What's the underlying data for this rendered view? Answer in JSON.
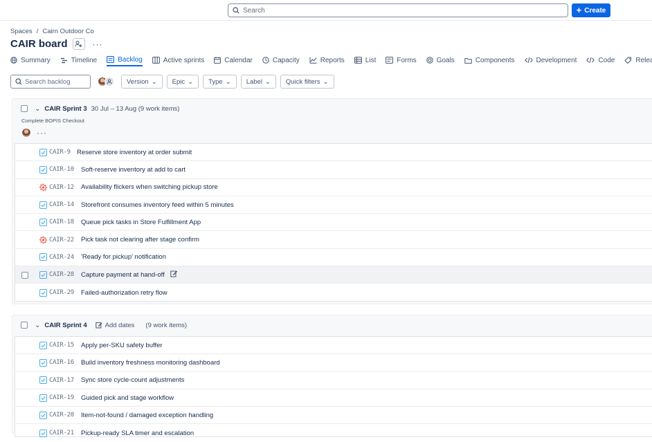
{
  "topbar": {
    "search_placeholder": "Search",
    "create_label": "Create"
  },
  "breadcrumbs": [
    "Spaces",
    "/",
    "Cairn Outdoor Co"
  ],
  "board_title": "CAIR board",
  "tabs": [
    {
      "label": "Summary",
      "icon": "globe-icon"
    },
    {
      "label": "Timeline",
      "icon": "timeline-icon"
    },
    {
      "label": "Backlog",
      "icon": "backlog-icon",
      "active": true
    },
    {
      "label": "Active sprints",
      "icon": "board-icon"
    },
    {
      "label": "Calendar",
      "icon": "calendar-icon"
    },
    {
      "label": "Capacity",
      "icon": "clock-icon"
    },
    {
      "label": "Reports",
      "icon": "chart-icon"
    },
    {
      "label": "List",
      "icon": "list-icon"
    },
    {
      "label": "Forms",
      "icon": "form-icon"
    },
    {
      "label": "Goals",
      "icon": "target-icon"
    },
    {
      "label": "Components",
      "icon": "component-icon"
    },
    {
      "label": "Development",
      "icon": "code-icon"
    },
    {
      "label": "Code",
      "icon": "code-icon"
    },
    {
      "label": "Releases",
      "icon": "release-icon"
    }
  ],
  "filters": {
    "search_placeholder": "Search backlog",
    "buttons": [
      "Version",
      "Epic",
      "Type",
      "Label",
      "Quick filters"
    ]
  },
  "sprints": [
    {
      "name": "CAIR Sprint 3",
      "meta": "30 Jul – 13 Aug (9 work items)",
      "goal": "Complete BOPIS Checkout",
      "items": [
        {
          "key": "CAIR-9",
          "summary": "Reserve store inventory at order submit",
          "type": "task"
        },
        {
          "key": "CAIR-10",
          "summary": "Soft-reserve inventory at add to cart",
          "type": "task"
        },
        {
          "key": "CAIR-12",
          "summary": "Availability flickers when switching pickup store",
          "type": "bug"
        },
        {
          "key": "CAIR-14",
          "summary": "Storefront consumes inventory feed within 5 minutes",
          "type": "task"
        },
        {
          "key": "CAIR-18",
          "summary": "Queue pick tasks in Store Fulfillment App",
          "type": "task"
        },
        {
          "key": "CAIR-22",
          "summary": "Pick task not clearing after stage confirm",
          "type": "bug"
        },
        {
          "key": "CAIR-24",
          "summary": "'Ready for pickup' notification",
          "type": "task"
        },
        {
          "key": "CAIR-28",
          "summary": "Capture payment at hand-off",
          "type": "task",
          "hover": true
        },
        {
          "key": "CAIR-29",
          "summary": "Failed-authorization retry flow",
          "type": "task"
        }
      ]
    },
    {
      "name": "CAIR Sprint 4",
      "add_dates": "Add dates",
      "meta": "(9 work items)",
      "items": [
        {
          "key": "CAIR-15",
          "summary": "Apply per-SKU safety buffer",
          "type": "task"
        },
        {
          "key": "CAIR-16",
          "summary": "Build inventory freshness monitoring dashboard",
          "type": "task"
        },
        {
          "key": "CAIR-17",
          "summary": "Sync store cycle-count adjustments",
          "type": "task"
        },
        {
          "key": "CAIR-19",
          "summary": "Guided pick and stage workflow",
          "type": "task"
        },
        {
          "key": "CAIR-20",
          "summary": "Item-not-found / damaged exception handling",
          "type": "task"
        },
        {
          "key": "CAIR-21",
          "summary": "Pickup-ready SLA timer and escalation",
          "type": "task"
        }
      ]
    }
  ],
  "colors": {
    "accent": "#0c66e4",
    "task": "#4bade8",
    "bug": "#e2483d"
  }
}
